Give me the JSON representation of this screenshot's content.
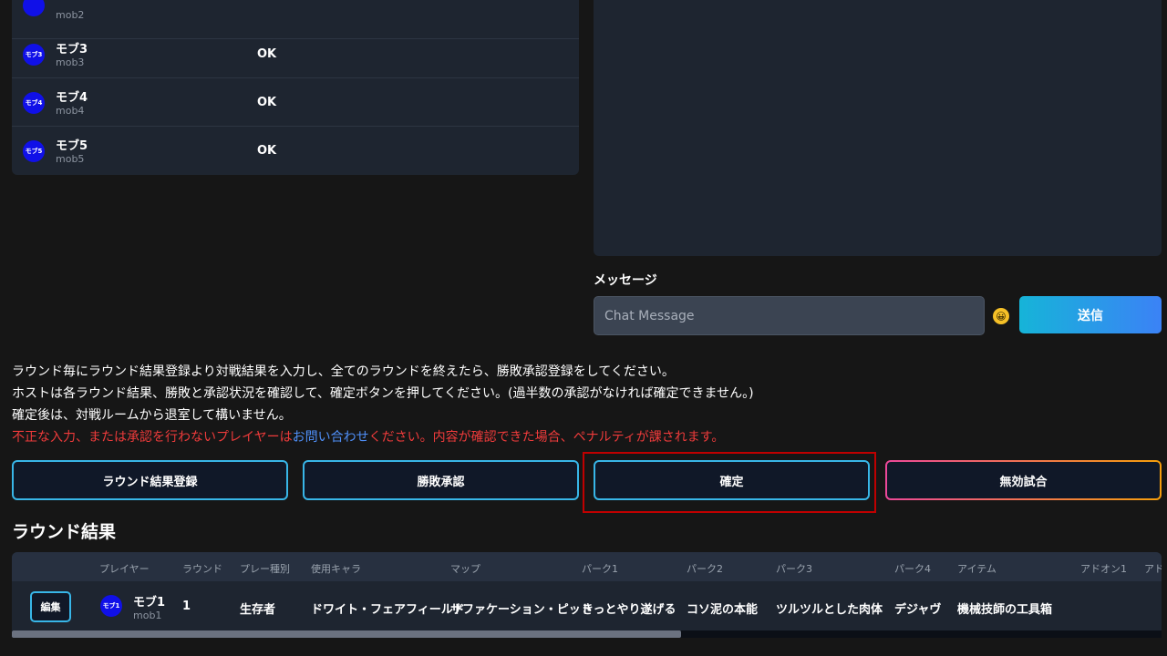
{
  "players": [
    {
      "name": "",
      "id": "mob2",
      "status": "",
      "avatar": ""
    },
    {
      "name": "モブ3",
      "id": "mob3",
      "status": "OK",
      "avatar": "モブ3"
    },
    {
      "name": "モブ4",
      "id": "mob4",
      "status": "OK",
      "avatar": "モブ4"
    },
    {
      "name": "モブ5",
      "id": "mob5",
      "status": "OK",
      "avatar": "モブ5"
    }
  ],
  "chat": {
    "message_label": "メッセージ",
    "input_placeholder": "Chat Message",
    "emoji": "😀",
    "send_label": "送信"
  },
  "instructions": {
    "line1": "ラウンド毎にラウンド結果登録より対戦結果を入力し、全てのラウンドを終えたら、勝敗承認登録をしてください。",
    "line2": "ホストは各ラウンド結果、勝敗と承認状況を確認して、確定ボタンを押してください。(過半数の承認がなければ確定できません。)",
    "line3": "確定後は、対戦ルームから退室して構いません。",
    "warning_before": "不正な入力、または承認を行わないプレイヤーは",
    "warning_link": "お問い合わせ",
    "warning_after": "ください。内容が確認できた場合、ペナルティが課されます。"
  },
  "actions": {
    "register_round": "ラウンド結果登録",
    "approve_result": "勝敗承認",
    "confirm": "確定",
    "invalid_match": "無効試合"
  },
  "round_results": {
    "title": "ラウンド結果",
    "headers": [
      "プレイヤー",
      "ラウンド",
      "プレー種別",
      "使用キャラ",
      "マップ",
      "パーク1",
      "パーク2",
      "パーク3",
      "パーク4",
      "アイテム",
      "アドオン1",
      "アド"
    ],
    "rows": [
      {
        "edit_label": "編集",
        "avatar": "モブ1",
        "player_name": "モブ1",
        "player_id": "mob1",
        "round": "1",
        "play_type": "生存者",
        "character": "ドワイト・フェアフィールド",
        "map": "サファケーション・ピット",
        "perk1": "きっとやり遂げる",
        "perk2": "コソ泥の本能",
        "perk3": "ツルツルとした肉体",
        "perk4": "デジャヴ",
        "item": "機械技師の工具箱"
      }
    ]
  },
  "colors": {
    "background": "#161616",
    "panel": "#1e2530",
    "accent_cyan": "#38b6e8",
    "warning_red": "#ef3b3b",
    "link_blue": "#4f8ff7",
    "highlight_frame": "#c00000",
    "avatar_blue": "#1010e8"
  }
}
